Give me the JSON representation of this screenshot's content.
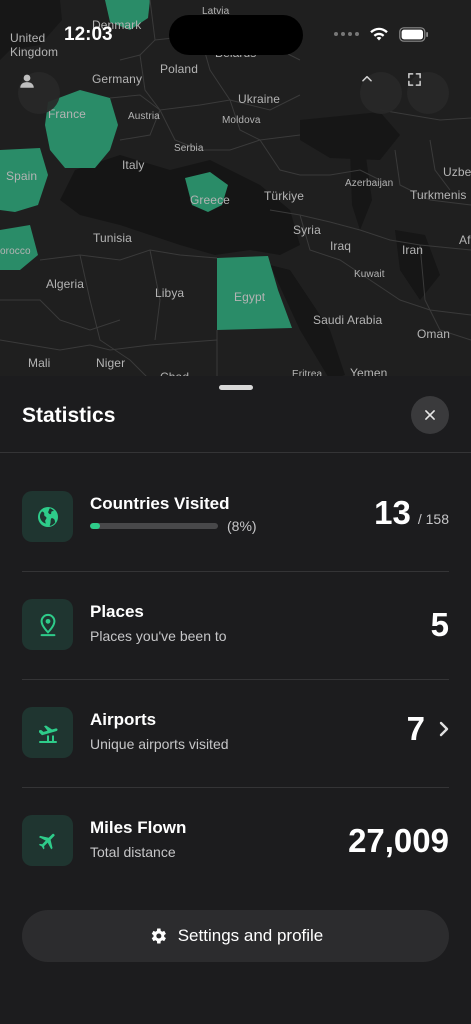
{
  "status_bar": {
    "time": "12:03"
  },
  "map": {
    "labels": {
      "latvia": "Latvia",
      "denmark": "Denmark",
      "united_kingdom": "United\nKingdom",
      "belarus": "Belarus",
      "poland": "Poland",
      "germany": "Germany",
      "ukraine": "Ukraine",
      "france": "France",
      "austria": "Austria",
      "moldova": "Moldova",
      "serbia": "Serbia",
      "italy": "Italy",
      "spain": "Spain",
      "greece": "Greece",
      "turkiye": "Türkiye",
      "azerbaijan": "Azerbaijan",
      "uzbekistan": "Uzbe",
      "turkmenistan": "Turkmenis",
      "syria": "Syria",
      "iraq": "Iraq",
      "iran": "Iran",
      "afghanistan": "Af",
      "tunisia": "Tunisia",
      "morocco": "orocco",
      "algeria": "Algeria",
      "libya": "Libya",
      "egypt": "Egypt",
      "kuwait": "Kuwait",
      "saudi_arabia": "Saudi Arabia",
      "oman": "Oman",
      "mali": "Mali",
      "niger": "Niger",
      "chad": "Chad",
      "eritrea": "Eritrea",
      "yemen": "Yemen"
    },
    "visited_color": "#2a8c68"
  },
  "sheet": {
    "title": "Statistics",
    "stats": [
      {
        "title": "Countries Visited",
        "value": "13",
        "total": "/ 158",
        "progress_label": "(8%)",
        "progress": 0.08
      },
      {
        "title": "Places",
        "subtitle": "Places you've been to",
        "value": "5"
      },
      {
        "title": "Airports",
        "subtitle": "Unique airports visited",
        "value": "7"
      },
      {
        "title": "Miles Flown",
        "subtitle": "Total distance",
        "value": "27,009"
      }
    ],
    "settings_label": "Settings and profile"
  },
  "colors": {
    "accent": "#2ecc8a",
    "icon_bg": "#1f3530",
    "sheet_bg": "#1c1c1e"
  }
}
